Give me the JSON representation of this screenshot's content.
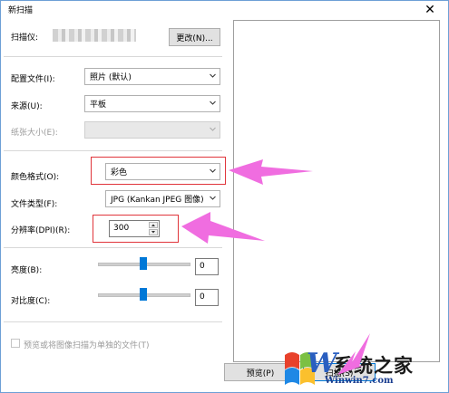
{
  "window": {
    "title": "新扫描",
    "close_glyph": "✕"
  },
  "scanner": {
    "label": "扫描仪:",
    "change_button": "更改(N)..."
  },
  "profile": {
    "label": "配置文件(I):",
    "value": "照片 (默认)"
  },
  "source": {
    "label": "来源(U):",
    "value": "平板"
  },
  "paper_size": {
    "label": "纸张大小(E):",
    "value": ""
  },
  "color_format": {
    "label": "颜色格式(O):",
    "value": "彩色"
  },
  "file_type": {
    "label": "文件类型(F):",
    "value": "JPG (Kankan JPEG 图像)"
  },
  "resolution": {
    "label": "分辨率(DPI)(R):",
    "value": "300"
  },
  "brightness": {
    "label": "亮度(B):",
    "value": "0",
    "level": 0.5
  },
  "contrast": {
    "label": "对比度(C):",
    "value": "0",
    "level": 0.5
  },
  "separate_files": {
    "label": "预览或将图像扫描为单独的文件(T)",
    "checked": false
  },
  "buttons": {
    "preview": "预览(P)",
    "scan": "扫描(S)"
  },
  "watermark": {
    "text": "系统之家",
    "url": "Winwin7.com",
    "letter": "W"
  },
  "colors": {
    "accent": "#0078d7",
    "highlight": "#e0353b",
    "arrow": "#f06de0"
  }
}
